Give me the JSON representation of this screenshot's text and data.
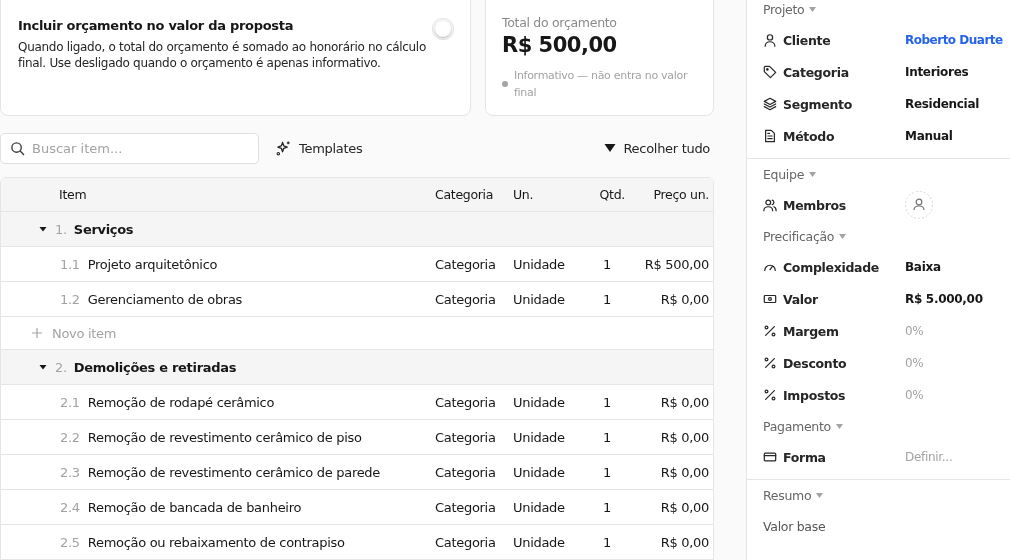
{
  "budget_toggle": {
    "title": "Incluir orçamento no valor da proposta",
    "description": "Quando ligado, o total do orçamento é somado ao honorário no cálculo final. Use desligado quando o orçamento é apenas informativo.",
    "on": false
  },
  "total": {
    "label": "Total do orçamento",
    "value": "R$ 500,00",
    "note": "Informativo — não entra no valor final"
  },
  "toolbar": {
    "search": {
      "placeholder": "Buscar item..."
    },
    "templates": "Templates",
    "collapse": "Recolher tudo"
  },
  "table": {
    "columns": [
      "Item",
      "Categoria",
      "Un.",
      "Qtd.",
      "Preço un."
    ],
    "rows": [
      {
        "kind": "group",
        "number": "1.",
        "name": "Serviços",
        "expanded": true
      },
      {
        "kind": "item",
        "number": "1.1",
        "name": "Projeto arquitetônico",
        "category": "Categoria",
        "unit": "Unidade",
        "qty": "1",
        "price": "R$ 500,00"
      },
      {
        "kind": "item",
        "number": "1.2",
        "name": "Gerenciamento de obras",
        "category": "Categoria",
        "unit": "Unidade",
        "qty": "1",
        "price": "R$ 0,00"
      },
      {
        "kind": "add",
        "name": "Novo item"
      },
      {
        "kind": "group",
        "number": "2.",
        "name": "Demolições e retiradas",
        "expanded": true
      },
      {
        "kind": "item",
        "number": "2.1",
        "name": "Remoção de rodapé cerâmico",
        "category": "Categoria",
        "unit": "Unidade",
        "qty": "1",
        "price": "R$ 0,00"
      },
      {
        "kind": "item",
        "number": "2.2",
        "name": "Remoção de revestimento cerâmico de piso",
        "category": "Categoria",
        "unit": "Unidade",
        "qty": "1",
        "price": "R$ 0,00"
      },
      {
        "kind": "item",
        "number": "2.3",
        "name": "Remoção de revestimento cerâmico de parede",
        "category": "Categoria",
        "unit": "Unidade",
        "qty": "1",
        "price": "R$ 0,00"
      },
      {
        "kind": "item",
        "number": "2.4",
        "name": "Remoção de bancada de banheiro",
        "category": "Categoria",
        "unit": "Unidade",
        "qty": "1",
        "price": "R$ 0,00"
      },
      {
        "kind": "item",
        "number": "2.5",
        "name": "Remoção ou rebaixamento de contrapiso",
        "category": "Categoria",
        "unit": "Unidade",
        "qty": "1",
        "price": "R$ 0,00"
      }
    ]
  },
  "sidebar": {
    "sections": [
      {
        "title": "Projeto",
        "separated": false,
        "fields": [
          {
            "label": "Cliente",
            "kind": "link",
            "value": "Roberto Duarte"
          },
          {
            "label": "Categoria",
            "kind": "text",
            "value": "Interiores"
          },
          {
            "label": "Segmento",
            "kind": "text",
            "value": "Residencial"
          },
          {
            "label": "Método",
            "kind": "text",
            "value": "Manual"
          }
        ]
      },
      {
        "title": "Equipe",
        "separated": true,
        "fields": [
          {
            "label": "Membros",
            "kind": "avatar"
          }
        ]
      },
      {
        "title": "Precificação",
        "separated": false,
        "fields": [
          {
            "label": "Complexidade",
            "kind": "text",
            "value": "Baixa"
          },
          {
            "label": "Valor",
            "kind": "text",
            "value": "R$ 5.000,00"
          },
          {
            "label": "Margem",
            "kind": "input",
            "placeholder": "0%"
          },
          {
            "label": "Desconto",
            "kind": "input",
            "placeholder": "0%"
          },
          {
            "label": "Impostos",
            "kind": "input",
            "placeholder": "0%"
          }
        ]
      },
      {
        "title": "Pagamento",
        "separated": false,
        "fields": [
          {
            "label": "Forma",
            "kind": "input",
            "placeholder": "Definir..."
          }
        ]
      },
      {
        "title": "Resumo",
        "separated": true,
        "fields": [
          {
            "label": "Valor base",
            "kind": "plain"
          }
        ]
      }
    ]
  }
}
